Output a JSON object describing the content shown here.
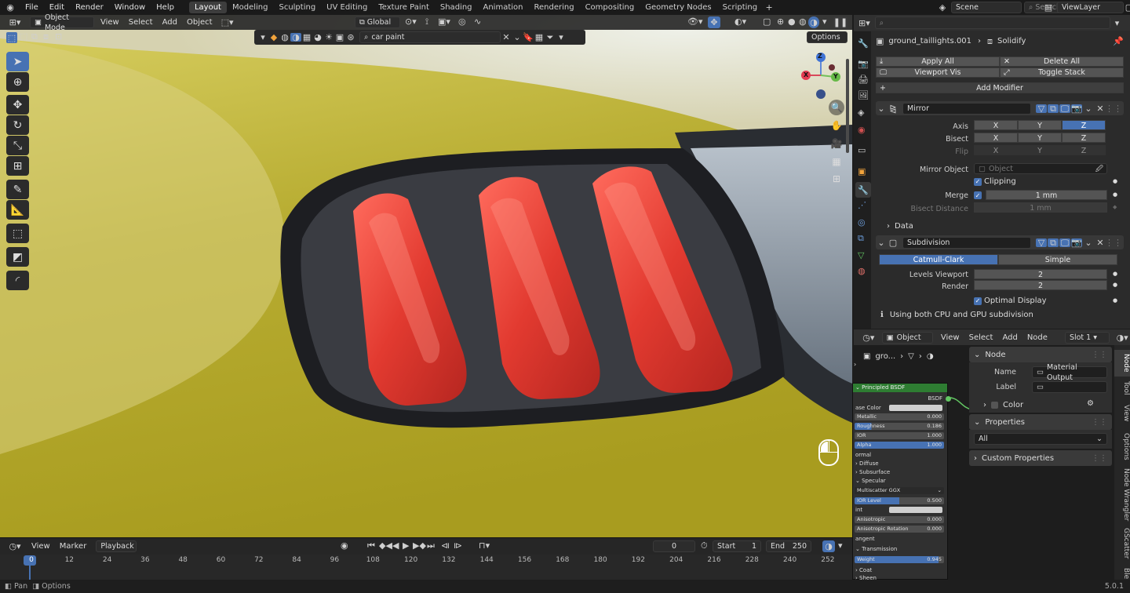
{
  "topbar": {
    "menus": [
      "File",
      "Edit",
      "Render",
      "Window",
      "Help"
    ],
    "tabs": [
      "Layout",
      "Modeling",
      "Sculpting",
      "UV Editing",
      "Texture Paint",
      "Shading",
      "Animation",
      "Rendering",
      "Compositing",
      "Geometry Nodes",
      "Scripting"
    ],
    "active_tab": "Layout",
    "scene": "Scene",
    "view_layer": "ViewLayer",
    "search_placeholder": "Search"
  },
  "viewport": {
    "mode": "Object Mode",
    "menus": [
      "View",
      "Select",
      "Add",
      "Object"
    ],
    "transform": "Global",
    "search_value": "car paint",
    "options_label": "Options",
    "gizmo": {
      "z": "Z",
      "x": "X",
      "y": "Y"
    }
  },
  "timeline": {
    "menus": [
      "View",
      "Marker"
    ],
    "playback": "Playback",
    "current_frame": "0",
    "start_label": "Start",
    "start": "1",
    "end_label": "End",
    "end": "250",
    "ticks": [
      "0",
      "12",
      "24",
      "36",
      "48",
      "60",
      "72",
      "84",
      "96",
      "108",
      "120",
      "132",
      "144",
      "156",
      "168",
      "180",
      "192",
      "204",
      "216",
      "228",
      "240",
      "252"
    ]
  },
  "status": {
    "left": "Pan",
    "mid": "Options",
    "version": "5.0.1"
  },
  "properties": {
    "object": "ground_taillights.001",
    "modifier_tab": "Solidify",
    "apply_all": "Apply All",
    "delete_all": "Delete All",
    "viewport_vis": "Viewport Vis",
    "toggle_stack": "Toggle Stack",
    "add_modifier": "Add Modifier",
    "mirror": {
      "name": "Mirror",
      "axis_label": "Axis",
      "bisect_label": "Bisect",
      "flip_label": "Flip",
      "axes": [
        "X",
        "Y",
        "Z"
      ],
      "mirror_object_label": "Mirror Object",
      "mirror_object_placeholder": "Object",
      "clipping": "Clipping",
      "merge_label": "Merge",
      "merge_value": "1 mm",
      "bisect_distance_label": "Bisect Distance",
      "bisect_distance_value": "1 mm",
      "data_label": "Data"
    },
    "subdivision": {
      "name": "Subdivision",
      "catmull": "Catmull-Clark",
      "simple": "Simple",
      "levels_label": "Levels Viewport",
      "levels": "2",
      "render_label": "Render",
      "render": "2",
      "optimal": "Optimal Display",
      "info": "Using both CPU and GPU subdivision"
    }
  },
  "node_editor": {
    "object_btn": "Object",
    "menus": [
      "View",
      "Select",
      "Add",
      "Node"
    ],
    "slot": "Slot 1",
    "breadcrumb": "gro...",
    "panel": {
      "node_title": "Node",
      "name_label": "Name",
      "name_value": "Material Output",
      "label_label": "Label",
      "color_label": "Color",
      "properties_title": "Properties",
      "properties_value": "All",
      "custom_title": "Custom Properties"
    },
    "tabs": [
      "Node",
      "Tool",
      "View",
      "Options",
      "Node Wrangler",
      "GScatter",
      "Ble"
    ],
    "bsdf": {
      "title": "Principled BSDF",
      "output": "BSDF",
      "base_color": "ase Color",
      "metallic_label": "Metallic",
      "metallic": "0.000",
      "roughness_label": "Roughness",
      "roughness": "0.186",
      "ior_label": "IOR",
      "ior": "1.000",
      "alpha_label": "Alpha",
      "alpha": "1.000",
      "normal": "ormal",
      "diffuse": "Diffuse",
      "subsurface": "Subsurface",
      "specular": "Specular",
      "distribution": "Multiscatter GGX",
      "ior_level_label": "IOR Level",
      "ior_level": "0.500",
      "tint": "int",
      "anisotropic_label": "Anisotropic",
      "anisotropic": "0.000",
      "aniso_rot_label": "Anisotropic Rotation",
      "aniso_rot": "0.000",
      "tangent": "angent",
      "transmission": "Transmission",
      "weight_label": "Weight",
      "weight": "0.945",
      "coat": "Coat",
      "sheen": "Sheen"
    }
  },
  "colors": {
    "accent": "#4772b3",
    "paint": "#c9bf3a",
    "tail_red": "#e63b32",
    "socket_green": "#63c763"
  }
}
